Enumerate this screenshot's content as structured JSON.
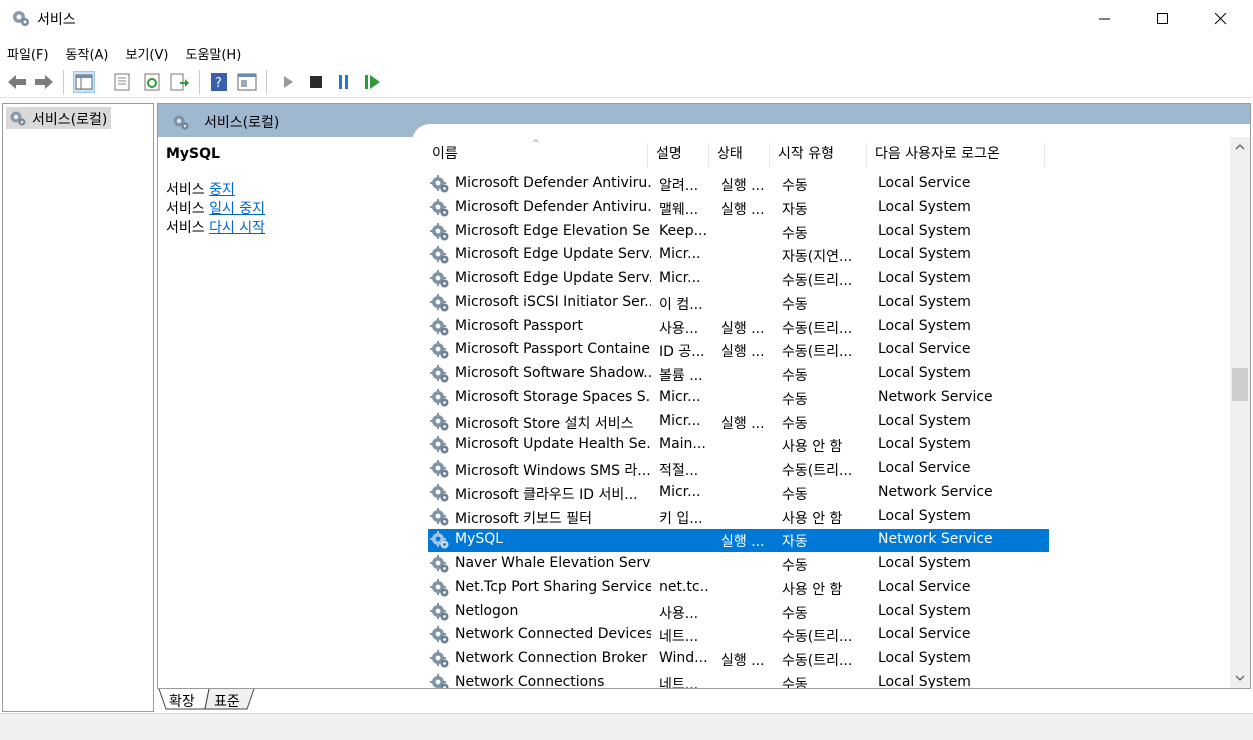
{
  "window": {
    "title": "서비스"
  },
  "menu": [
    "파일(F)",
    "동작(A)",
    "보기(V)",
    "도움말(H)"
  ],
  "tree": {
    "root_label": "서비스(로컬)"
  },
  "pane": {
    "title": "서비스(로컬)"
  },
  "description": {
    "service_name": "MySQL",
    "actions": [
      {
        "prefix": "서비스 ",
        "link": "중지"
      },
      {
        "prefix": "서비스 ",
        "link": "일시 중지"
      },
      {
        "prefix": "서비스 ",
        "link": "다시 시작"
      }
    ]
  },
  "table": {
    "columns": {
      "name": "이름",
      "desc": "설명",
      "status": "상태",
      "start": "시작 유형",
      "logon": "다음 사용자로 로그온"
    },
    "rows": [
      {
        "name": "Microsoft Defender Antiviru...",
        "desc": "알려...",
        "status": "실행 ...",
        "start": "수동",
        "logon": "Local Service"
      },
      {
        "name": "Microsoft Defender Antiviru...",
        "desc": "맬웨...",
        "status": "실행 ...",
        "start": "자동",
        "logon": "Local System"
      },
      {
        "name": "Microsoft Edge Elevation Se...",
        "desc": "Keep...",
        "status": "",
        "start": "수동",
        "logon": "Local System"
      },
      {
        "name": "Microsoft Edge Update Serv...",
        "desc": "Micr...",
        "status": "",
        "start": "자동(지연...",
        "logon": "Local System"
      },
      {
        "name": "Microsoft Edge Update Serv...",
        "desc": "Micr...",
        "status": "",
        "start": "수동(트리...",
        "logon": "Local System"
      },
      {
        "name": "Microsoft iSCSI Initiator Ser...",
        "desc": "이 컴...",
        "status": "",
        "start": "수동",
        "logon": "Local System"
      },
      {
        "name": "Microsoft Passport",
        "desc": "사용...",
        "status": "실행 ...",
        "start": "수동(트리...",
        "logon": "Local System"
      },
      {
        "name": "Microsoft Passport Container",
        "desc": "ID 공...",
        "status": "실행 ...",
        "start": "수동(트리...",
        "logon": "Local Service"
      },
      {
        "name": "Microsoft Software Shadow...",
        "desc": "볼륨 ...",
        "status": "",
        "start": "수동",
        "logon": "Local System"
      },
      {
        "name": "Microsoft Storage Spaces S...",
        "desc": "Micr...",
        "status": "",
        "start": "수동",
        "logon": "Network Service"
      },
      {
        "name": "Microsoft Store 설치 서비스",
        "desc": "Micr...",
        "status": "실행 ...",
        "start": "수동",
        "logon": "Local System"
      },
      {
        "name": "Microsoft Update Health Se...",
        "desc": "Main...",
        "status": "",
        "start": "사용 안 함",
        "logon": "Local System"
      },
      {
        "name": "Microsoft Windows SMS 라...",
        "desc": "적절...",
        "status": "",
        "start": "수동(트리...",
        "logon": "Local Service"
      },
      {
        "name": "Microsoft 클라우드 ID 서비...",
        "desc": "Micr...",
        "status": "",
        "start": "수동",
        "logon": "Network Service"
      },
      {
        "name": "Microsoft 키보드 필터",
        "desc": "키 입...",
        "status": "",
        "start": "사용 안 함",
        "logon": "Local System"
      },
      {
        "name": "MySQL",
        "desc": "",
        "status": "실행 ...",
        "start": "자동",
        "logon": "Network Service",
        "selected": true
      },
      {
        "name": "Naver Whale Elevation Serv...",
        "desc": "",
        "status": "",
        "start": "수동",
        "logon": "Local System"
      },
      {
        "name": "Net.Tcp Port Sharing Service",
        "desc": "net.tc...",
        "status": "",
        "start": "사용 안 함",
        "logon": "Local Service"
      },
      {
        "name": "Netlogon",
        "desc": "사용...",
        "status": "",
        "start": "수동",
        "logon": "Local System"
      },
      {
        "name": "Network Connected Devices...",
        "desc": "네트...",
        "status": "",
        "start": "수동(트리...",
        "logon": "Local Service"
      },
      {
        "name": "Network Connection Broker",
        "desc": "Wind...",
        "status": "실행 ...",
        "start": "수동(트리...",
        "logon": "Local System"
      },
      {
        "name": "Network Connections",
        "desc": "네트...",
        "status": "",
        "start": "수동",
        "logon": "Local System"
      }
    ]
  },
  "tabs": [
    "확장",
    "표준"
  ],
  "colors": {
    "selection": "#0078d7",
    "pane_header": "#9fb7cf",
    "link": "#0066cc"
  },
  "icons": {
    "toolbar": [
      "back-arrow-icon",
      "forward-arrow-icon",
      "console-tree-icon",
      "properties-icon",
      "refresh-icon",
      "export-list-icon",
      "help-icon",
      "view-icon",
      "start-service-icon",
      "stop-service-icon",
      "pause-service-icon",
      "restart-service-icon"
    ],
    "service": "gear-icon"
  }
}
